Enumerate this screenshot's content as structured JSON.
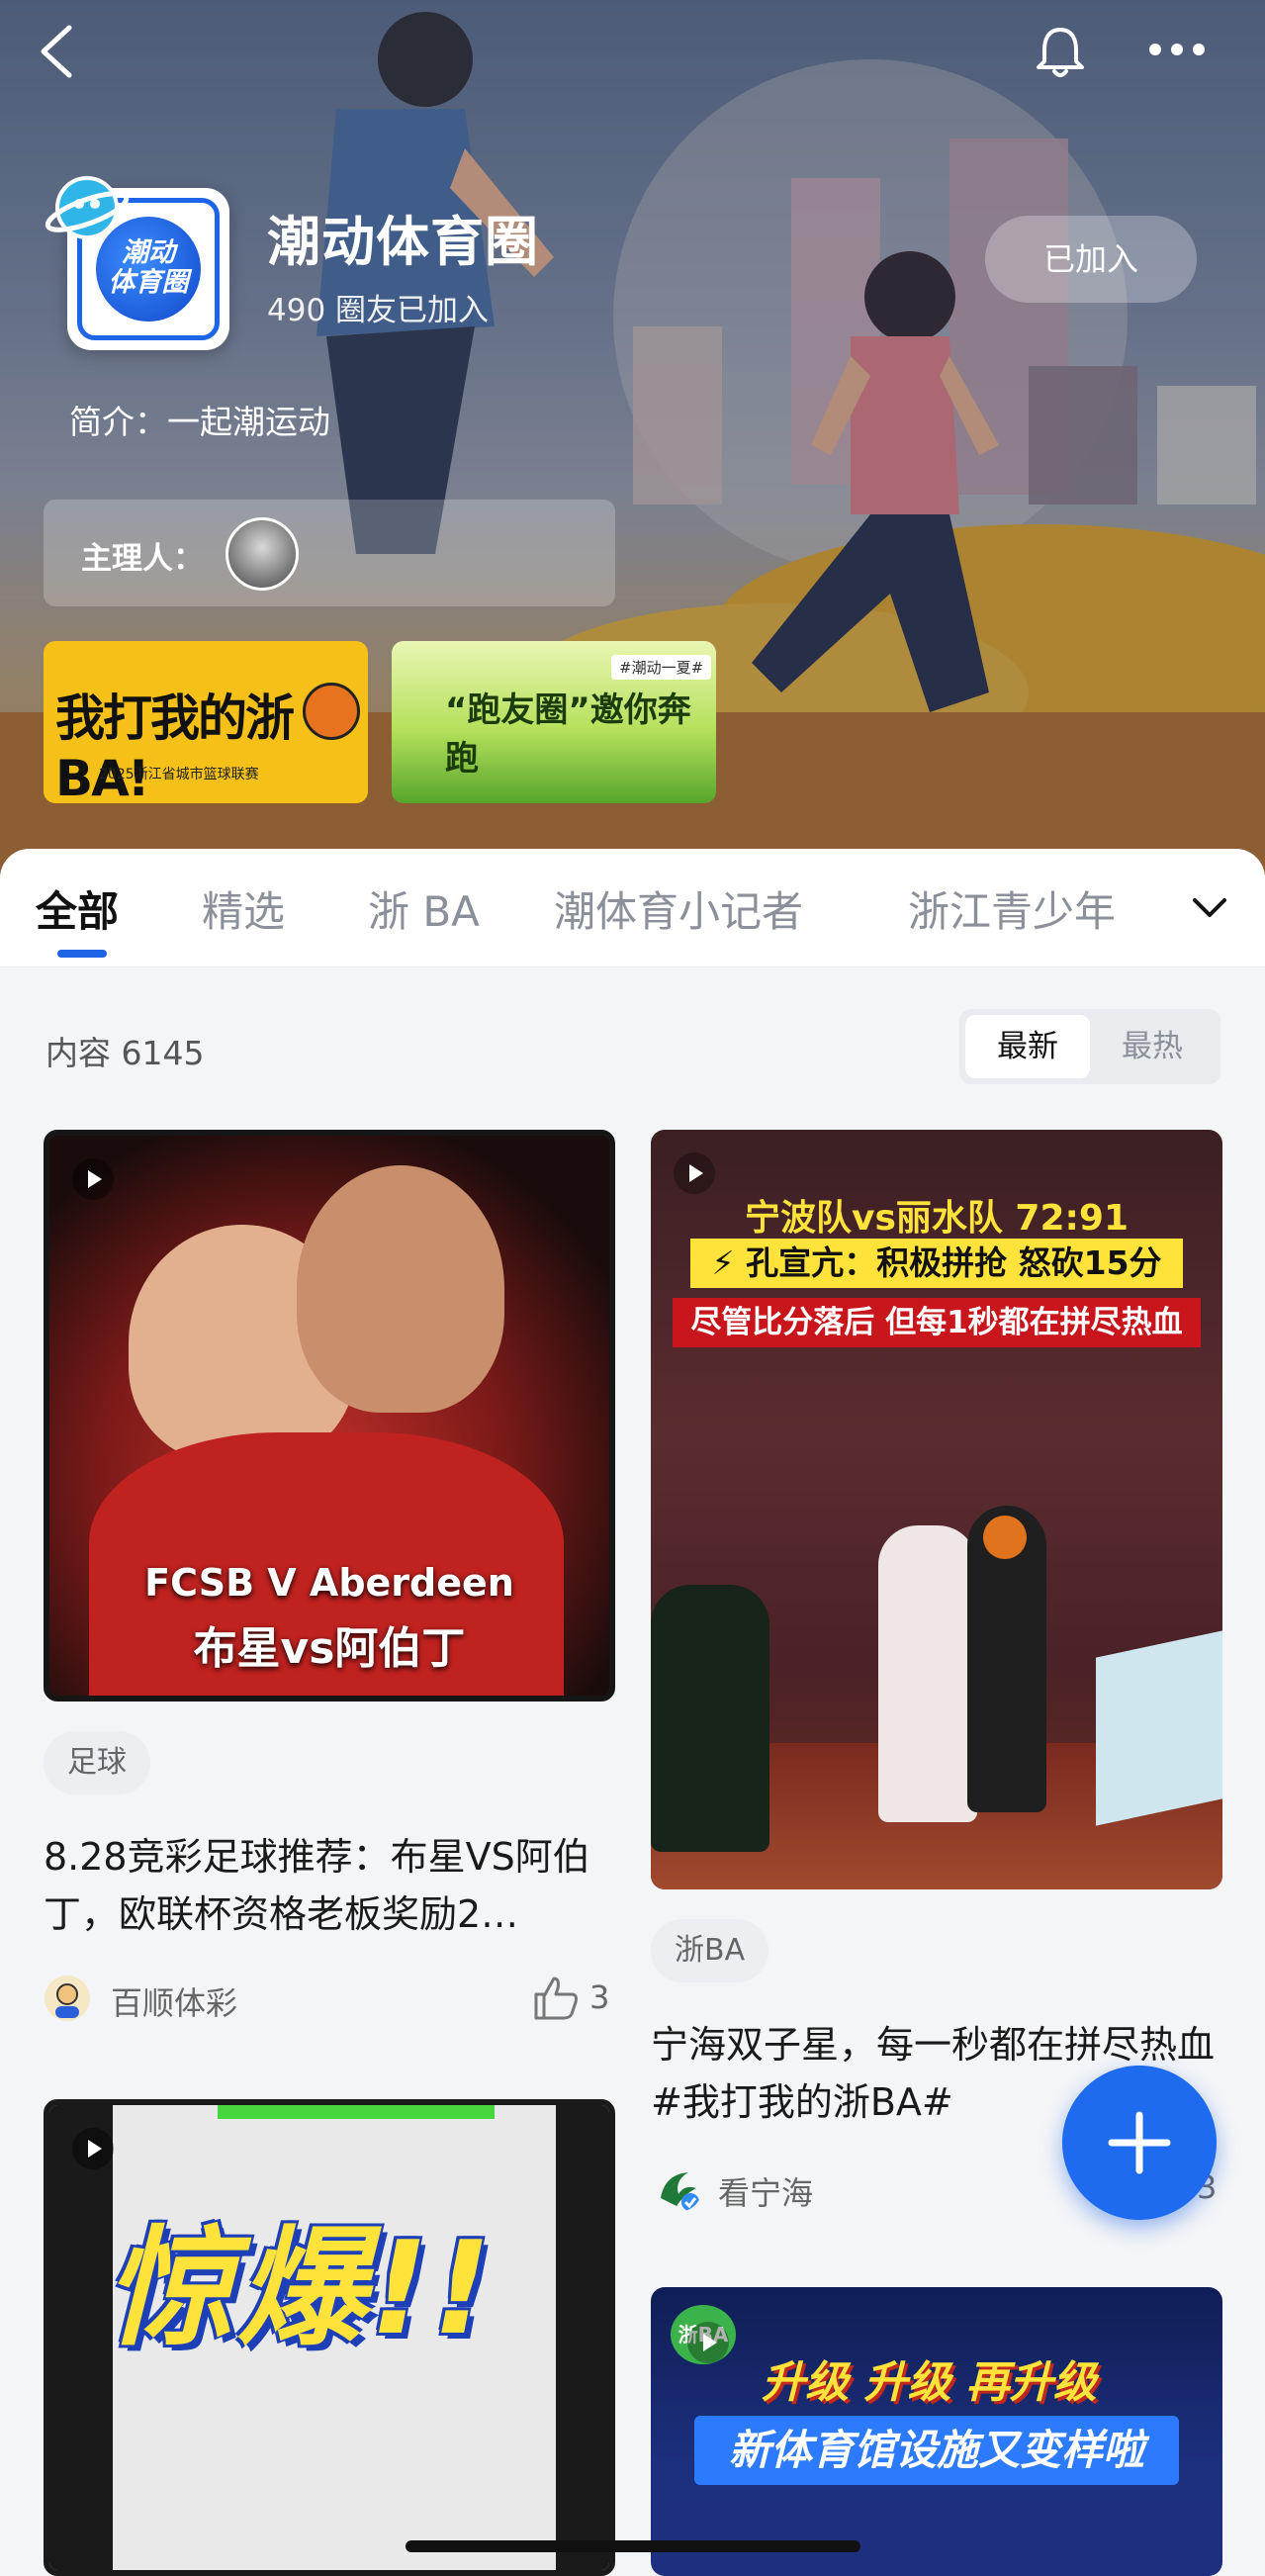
{
  "header": {
    "group_name": "潮动体育圈",
    "members_text": "490 圈友已加入",
    "joined_button": "已加入",
    "intro": "简介：一起潮运动",
    "manager_label": "主理人："
  },
  "logo": {
    "text_line1": "潮动",
    "text_line2": "体育圈"
  },
  "banners": [
    {
      "title": "我打我的浙BA!",
      "subtitle": "2025浙江省城市篮球联赛"
    },
    {
      "title": "“跑友圈”邀你奔跑",
      "tag": "#潮动一夏#"
    }
  ],
  "tabs": [
    {
      "label": "全部",
      "active": true
    },
    {
      "label": "精选"
    },
    {
      "label": "浙 BA"
    },
    {
      "label": "潮体育小记者"
    },
    {
      "label": "浙江青少年"
    }
  ],
  "content": {
    "count_label": "内容 6145",
    "sort_options": [
      "最新",
      "最热"
    ]
  },
  "posts": [
    {
      "thumb_title_en": "FCSB V Aberdeen",
      "thumb_title_zh": "布星vs阿伯丁",
      "tag": "足球",
      "title": "8.28竞彩足球推荐：布星VS阿伯丁，欧联杯资格老板奖励2…",
      "author": "百顺体彩",
      "likes": "3"
    },
    {
      "thumb_line1": "宁波队vs丽水队  72:91",
      "thumb_line2": "⚡ 孔宣亢：积极拼抢  怒砍15分",
      "thumb_line3": "尽管比分落后 但每1秒都在拼尽热血",
      "tag": "浙BA",
      "title": "宁海双子星，每一秒都在拼尽热血#我打我的浙BA#",
      "author": "看宁海",
      "likes": "3"
    },
    {
      "thumb_big": "惊爆!!"
    },
    {
      "thumb_logo": "浙BA",
      "thumb_line1": "升级 升级 再升级",
      "thumb_line2": "新体育馆设施又变样啦"
    }
  ],
  "colors": {
    "accent": "#1e64e6",
    "fab": "#1e6bf0"
  }
}
